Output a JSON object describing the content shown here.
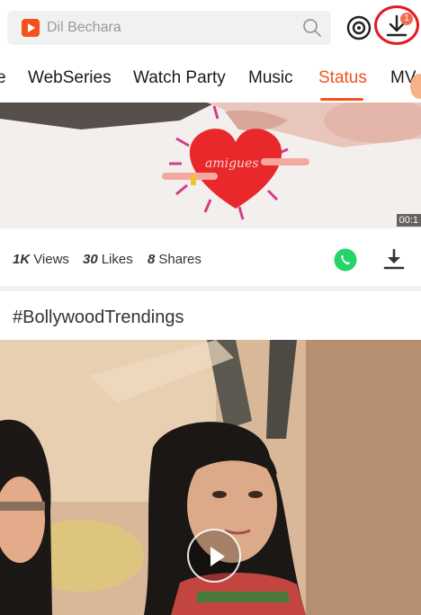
{
  "search": {
    "placeholder": "Dil Bechara"
  },
  "header": {
    "download_badge": "1"
  },
  "tabs": [
    {
      "label": "e"
    },
    {
      "label": "WebSeries"
    },
    {
      "label": "Watch Party"
    },
    {
      "label": "Music"
    },
    {
      "label": "Status",
      "active": true
    },
    {
      "label": "MV"
    }
  ],
  "video1": {
    "overlay_text": "amigues",
    "duration": "00:1"
  },
  "stats": {
    "views_count": "1K",
    "views_label": "Views",
    "likes_count": "30",
    "likes_label": "Likes",
    "shares_count": "8",
    "shares_label": "Shares"
  },
  "section": {
    "hashtag": "#BollywoodTrendings"
  },
  "colors": {
    "accent": "#f4511e",
    "highlight_circle": "#e31b23",
    "whatsapp": "#25d366"
  },
  "icons": [
    "app-logo-icon",
    "search-icon",
    "disc-icon",
    "download-icon",
    "whatsapp-icon",
    "play-icon"
  ]
}
